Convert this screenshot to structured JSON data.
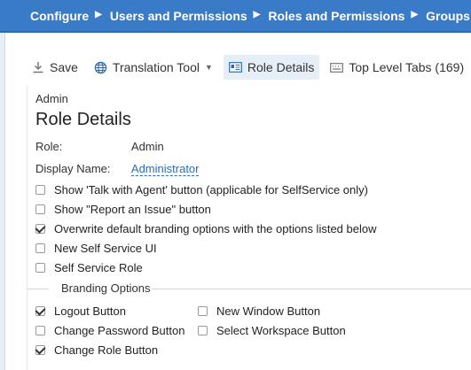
{
  "breadcrumb": {
    "items": [
      "Configure",
      "Users and Permissions",
      "Roles and Permissions",
      "Groups"
    ],
    "separator": "▶"
  },
  "toolbar": {
    "save_label": "Save",
    "translation_label": "Translation Tool",
    "role_details_label": "Role Details",
    "top_level_tabs_label": "Top Level Tabs (169)"
  },
  "page": {
    "eyebrow": "Admin",
    "title": "Role Details"
  },
  "fields": {
    "role_label": "Role:",
    "role_value": "Admin",
    "display_name_label": "Display Name:",
    "display_name_value": "Administrator"
  },
  "options": [
    {
      "label": "Show 'Talk with Agent' button (applicable for SelfService only)",
      "checked": false
    },
    {
      "label": "Show \"Report an Issue\" button",
      "checked": false
    },
    {
      "label": "Overwrite default branding options with the options listed below",
      "checked": true
    },
    {
      "label": "New Self Service UI",
      "checked": false
    },
    {
      "label": "Self Service Role",
      "checked": false
    }
  ],
  "branding": {
    "title": "Branding Options",
    "left": [
      {
        "label": "Logout Button",
        "checked": true
      },
      {
        "label": "Change Password Button",
        "checked": false
      },
      {
        "label": "Change Role Button",
        "checked": true
      }
    ],
    "right": [
      {
        "label": "New Window Button",
        "checked": false
      },
      {
        "label": "Select Workspace Button",
        "checked": false
      }
    ]
  },
  "colors": {
    "header_bg": "#3a7bc8",
    "link": "#2a6db5"
  }
}
